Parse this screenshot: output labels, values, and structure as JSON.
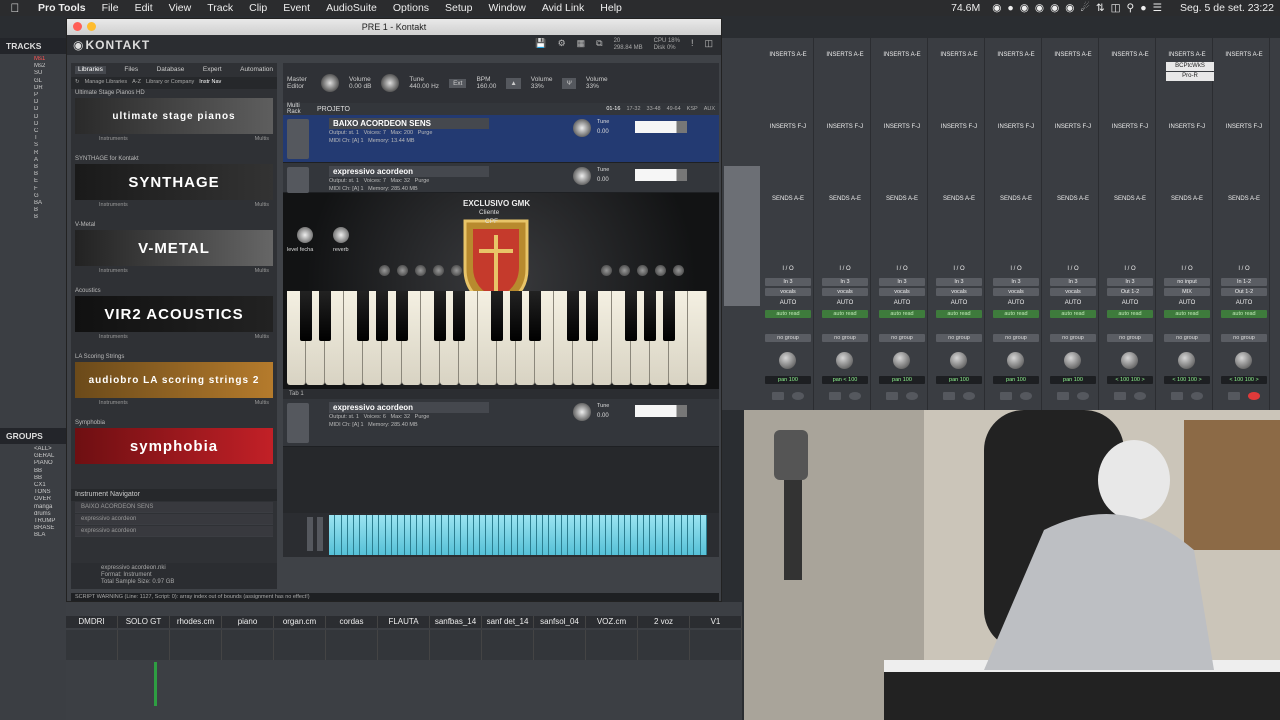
{
  "menubar": {
    "app": "Pro Tools",
    "items": [
      "File",
      "Edit",
      "View",
      "Track",
      "Clip",
      "Event",
      "AudioSuite",
      "Options",
      "Setup",
      "Window",
      "Avid Link",
      "Help"
    ],
    "status_mem": "74.6M",
    "datetime": "Seg. 5 de set.  23:22"
  },
  "pt_left": {
    "tracks_label": "TRACKS",
    "tracks": [
      "Ms1",
      "Ms2",
      "SU",
      "GL",
      "DR",
      "P",
      "D",
      "D",
      "D",
      "D",
      "C",
      "T",
      "S",
      "R",
      "A",
      "B",
      "B",
      "E",
      "F",
      "G",
      "BA",
      "B",
      "B"
    ],
    "groups_label": "GROUPS",
    "groups": [
      "<ALL>",
      "GERAL",
      "PIANO",
      "BB",
      "BB",
      "CX1",
      "TONS",
      "OVER",
      "manga",
      "drums",
      "TRUMP",
      "BRASE",
      "BLA"
    ]
  },
  "kontakt": {
    "window_title": "PRE 1 - Kontakt",
    "logo": "KONTAKT",
    "cpu_line1": "CPU 18%",
    "cpu_line2": "Disk 0%",
    "mem_line1": "20",
    "mem_line2": "298.84 MB",
    "browser_tabs": [
      "Libraries",
      "Files",
      "Database",
      "Expert",
      "Automation"
    ],
    "browser_tools": [
      "Manage Libraries",
      "A-Z",
      "Library or Company",
      "Instr Nav"
    ],
    "libraries": [
      {
        "name": "Ultimate Stage Pianos HD",
        "banner": "ultimate stage pianos",
        "type": "Instruments",
        "multi": "Multis"
      },
      {
        "name": "SYNTHAGE for Kontakt",
        "banner": "SYNTHAGE",
        "type": "Instruments",
        "multi": "Multis"
      },
      {
        "name": "V-Metal",
        "banner": "V-METAL",
        "type": "Instruments",
        "multi": "Multis"
      },
      {
        "name": "Acoustics",
        "banner": "VIR2 ACOUSTICS",
        "type": "Instruments",
        "multi": "Multis"
      },
      {
        "name": "LA Scoring Strings",
        "banner": "audiobro LA scoring strings 2",
        "type": "Instruments",
        "multi": "Multis"
      },
      {
        "name": "Symphobia",
        "banner": "symphobia",
        "type": "",
        "multi": ""
      }
    ],
    "navigator_title": "Instrument Navigator",
    "navigator_items": [
      "BAIXO ACORDEON SENS",
      "expressivo acordeon",
      "expressivo acordeon"
    ],
    "file_info_name": "expressivo acordeon.nki",
    "file_info_format": "Format: Instrument",
    "file_info_size": "Total Sample Size: 0.97 GB",
    "warning": "SCRIPT WARNING (Line: 1127, Script: 0): array index out of bounds (assignment has no effect!)",
    "master": {
      "label": "Master Editor",
      "volume_label": "Volume",
      "volume_value": "0.00  dB",
      "tune_label": "Tune",
      "tune_value": "440.00  Hz",
      "ext": "Ext",
      "bpm_label": "BPM",
      "bpm_value": "160.00",
      "vol2_label": "Volume",
      "vol2_value": "33%",
      "vol3_label": "Volume",
      "vol3_value": "33%"
    },
    "rack_label": "Multi Rack",
    "rack_name": "PROJETO",
    "rack_pages": [
      "01-16",
      "17-32",
      "33-48",
      "49-64",
      "KSP",
      "AUX"
    ],
    "instruments": [
      {
        "name": "BAIXO ACORDEON SENS",
        "output": "Output: st. 1",
        "midi": "MIDI Ch: [A] 1",
        "voices": "Voices: 7",
        "max": "Max: 200",
        "memory": "Memory: 13.44 MB",
        "purge": "Purge",
        "tune_label": "Tune",
        "tune_value": "0.00"
      },
      {
        "name": "expressivo acordeon",
        "output": "Output: st. 1",
        "midi": "MIDI Ch: [A] 1",
        "voices": "Voices: 7",
        "max": "Max: 32",
        "memory": "Memory: 285.40 MB",
        "purge": "Purge",
        "tune_label": "Tune",
        "tune_value": "0.00"
      },
      {
        "name": "expressivo acordeon",
        "output": "Output: st. 1",
        "midi": "MIDI Ch: [A] 1",
        "voices": "Voices: 6",
        "max": "Max: 32",
        "memory": "Memory: 285.40 MB",
        "purge": "Purge",
        "tune_label": "Tune",
        "tune_value": "0.00"
      }
    ],
    "accordion_text1": "EXCLUSIVO GMK",
    "accordion_text2": "Cliente",
    "accordion_text3": "CPF",
    "level_label": "level fecha",
    "reverb_label": "reverb",
    "tab_label": "Tab 1"
  },
  "mixer": {
    "insert_label": "INSERTS A-E",
    "insert_label2": "INSERTS F-J",
    "sends_label": "SENDS A-E",
    "io_label": "I / O",
    "auto_label": "AUTO",
    "no_group": "no group",
    "strips": [
      {
        "input": "In 3",
        "output": "vocals",
        "auto": "auto read",
        "pan": "pan 100"
      },
      {
        "input": "In 3",
        "output": "vocals",
        "auto": "auto read",
        "pan": "pan < 100"
      },
      {
        "input": "In 3",
        "output": "vocals",
        "auto": "auto read",
        "pan": "pan 100"
      },
      {
        "input": "In 3",
        "output": "vocals",
        "auto": "auto read",
        "pan": "pan 100"
      },
      {
        "input": "In 3",
        "output": "vocals",
        "auto": "auto read",
        "pan": "pan 100"
      },
      {
        "input": "In 3",
        "output": "vocals",
        "auto": "auto read",
        "pan": "pan 100"
      },
      {
        "input": "In 3",
        "output": "Out 1-2",
        "auto": "auto read",
        "pan": "< 100  100 >"
      },
      {
        "input": "no input",
        "output": "MIX",
        "auto": "auto read",
        "pan": "< 100  100 >"
      },
      {
        "input": "In 1-2",
        "output": "Out 1-2",
        "auto": "auto read",
        "pan": "< 100  100 >"
      }
    ],
    "plugins": [
      "BCPtcWkS",
      "Pro-R"
    ]
  },
  "lower_mixer": {
    "names": [
      "DMDRI",
      "SOLO GT",
      "rhodes.cm",
      "piano",
      "organ.cm",
      "cordas",
      "FLAUTA",
      "sanfbas_14",
      "sanf det_14",
      "sanfsol_04",
      "VOZ.cm",
      "2 voz",
      "V1"
    ]
  }
}
